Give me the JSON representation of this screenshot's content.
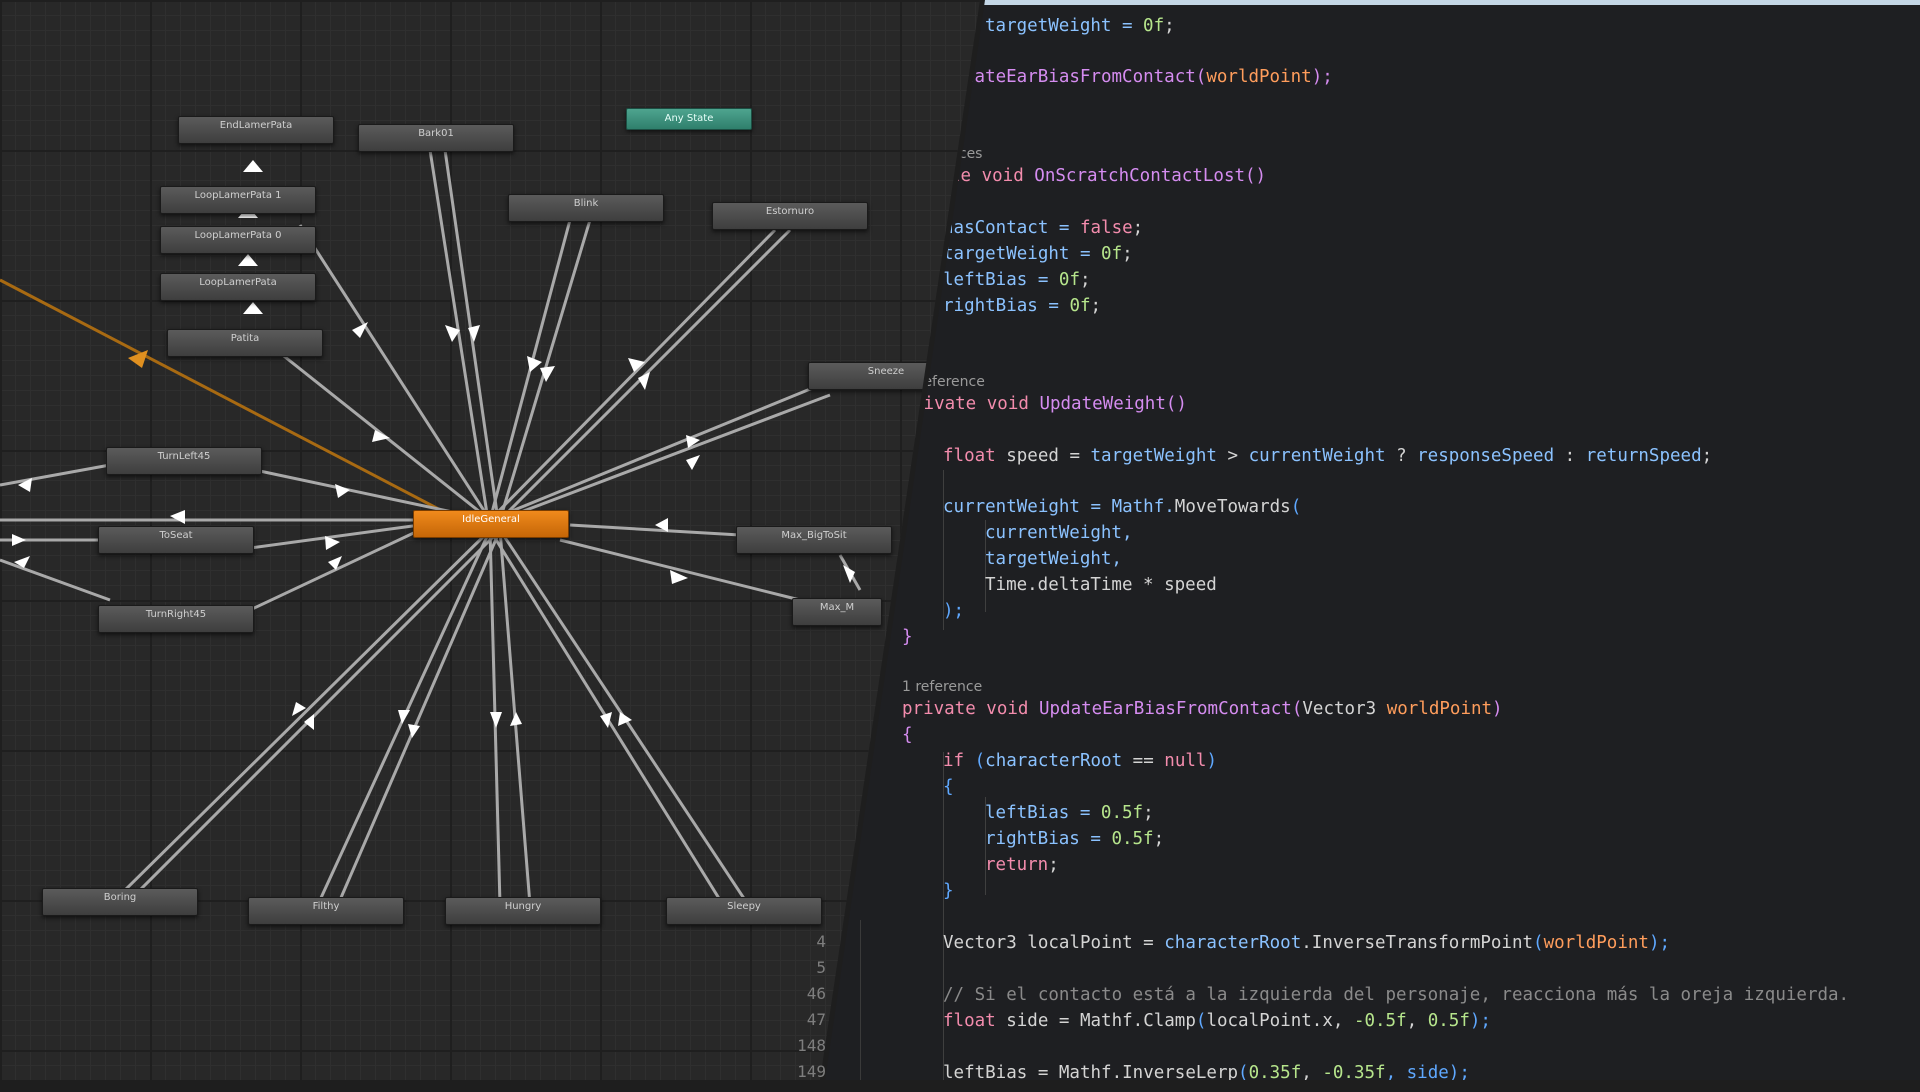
{
  "animator": {
    "entry_state": "IdleGeneral",
    "any_state": "Any State",
    "states": [
      "EndLamerPata",
      "Bark01",
      "Any State",
      "LoopLamerPata 1",
      "Blink",
      "Estornuro",
      "LoopLamerPata 0",
      "LoopLamerPata",
      "Patita",
      "Sneeze",
      "TurnLeft45",
      "ToSeat",
      "Max_BigToSit",
      "TurnRight45",
      "Max_M",
      "Boring",
      "Filthy",
      "Hungry",
      "Sleepy"
    ]
  },
  "editor": {
    "line_numbers": [
      "4",
      "5",
      "46",
      "47",
      "148",
      "149"
    ],
    "hints": {
      "refs_a": "nces",
      "refs_b": "reference",
      "refs_c": "1 reference"
    },
    "code": {
      "l01": [
        "targetWeight = ",
        "0f",
        ";"
      ],
      "l02": [
        "dateEarBiasFromContact",
        "(",
        "worldPoint",
        ");"
      ],
      "l04_kw": "te void ",
      "l04_fn": "OnScratchContactLost",
      "l04_p": "()",
      "l05": [
        "hasContact = ",
        "false",
        ";"
      ],
      "l06": [
        "targetWeight = ",
        "0f",
        ";"
      ],
      "l07": [
        "leftBias = ",
        "0f",
        ";"
      ],
      "l08": [
        "rightBias = ",
        "0f",
        ";"
      ],
      "l10_kw": "rivate void ",
      "l10_fn": "UpdateWeight",
      "l10_p": "()",
      "l11": "{",
      "l12": [
        "float",
        " speed = ",
        "targetWeight",
        " > ",
        "currentWeight",
        " ? ",
        "responseSpeed",
        " : ",
        "returnSpeed",
        ";"
      ],
      "l13": [
        "currentWeight = Mathf.",
        "MoveTowards",
        "("
      ],
      "l14": "currentWeight,",
      "l15": "targetWeight,",
      "l16": "Time.deltaTime * speed",
      "l17": ");",
      "l18": "}",
      "l19_kw": "private void ",
      "l19_fn": "UpdateEarBiasFromContact",
      "l19_a": "(",
      "l19_t": "Vector3 ",
      "l19_par": "worldPoint",
      "l19_b": ")",
      "l20": "{",
      "l21": [
        "if",
        " (",
        "characterRoot",
        " == ",
        "null",
        ")"
      ],
      "l22": "{",
      "l23": [
        "leftBias = ",
        "0.5f",
        ";"
      ],
      "l24": [
        "rightBias = ",
        "0.5f",
        ";"
      ],
      "l25": [
        "return",
        ";"
      ],
      "l26": "}",
      "l27": [
        "Vector3 localPoint = ",
        "characterRoot",
        ".",
        "InverseTransformPoint",
        "(",
        "worldPoint",
        ");"
      ],
      "l28": "// Si el contacto está a la izquierda del personaje, reacciona más la oreja izquierda.",
      "l29": [
        "float",
        " side = Mathf.",
        "Clamp",
        "(",
        "localPoint.x, ",
        "-0.5f",
        ", ",
        "0.5f",
        ");"
      ],
      "l30": [
        "leftBias = Mathf.",
        "InverseLerp",
        "(",
        "0.35f",
        ", ",
        "-0.35f",
        ", side);"
      ]
    }
  }
}
